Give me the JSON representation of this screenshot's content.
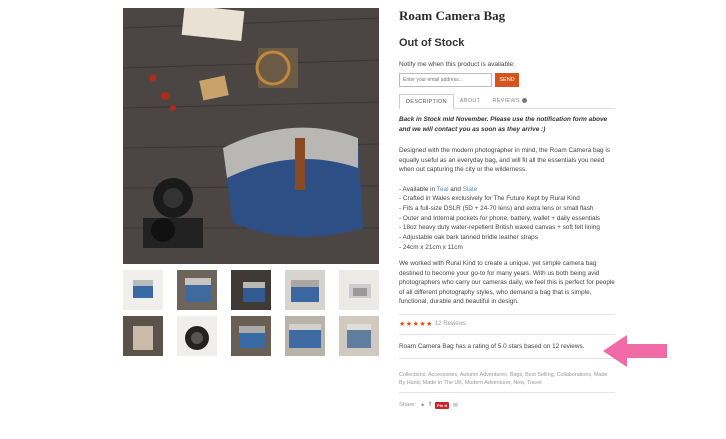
{
  "product": {
    "title": "Roam Camera Bag",
    "stock_status": "Out of Stock",
    "notify_text": "Notify me when this product is available:",
    "email_placeholder": "Enter your email address...",
    "send_label": "SEND"
  },
  "tabs": [
    {
      "label": "DESCRIPTION",
      "active": true
    },
    {
      "label": "ABOUT",
      "active": false
    },
    {
      "label": "REVIEWS",
      "active": false
    }
  ],
  "description": {
    "notice": "Back in Stock mid November. Please use the notification form above and we will contact you as soon as they arrive :)",
    "intro": "Designed with the modern photographer in mind, the Roam Camera bag is equally useful as an everyday bag, and will fit all the essentials you need when out capturing the city or the wilderness.",
    "available_prefix": "- Available in ",
    "color_teal": "Teal",
    "and_word": " and ",
    "color_slate": "Slate",
    "features": [
      "- Crafted in Wales exclusively for The Future Kept by Rural Kind",
      "- Fits a full-size DSLR (5D + 24-70 lens) and extra lens or small flash",
      "- Outer and Internal pockets for phone, battery, wallet + daily essentials",
      "- 18oz heavy duty water-repellent British waxed canvas + soft felt lining",
      "- Adjustable oak bark tanned bridle leather straps",
      "- 24cm x 21cm x 11cm"
    ],
    "closing": "We worked with Rural Kind to create a unique, yet simple camera bag destined to become your go-to for many years. With us both being avid photographers who carry our cameras daily, we feel this is perfect for people of all different photography styles, who demand a bag that is simple, functional, durable and beautiful in design."
  },
  "rating": {
    "stars": 5,
    "review_count_label": "12 Reviews",
    "summary": "Roam Camera Bag has a rating of 5.0 stars based on 12 reviews."
  },
  "collections": "Collections: Accessories, Autumn Adventures, Bags, Best Selling, Collaborations, Made By Hand, Made In The UK, Modern Adventurer, New, Travel",
  "share": {
    "label": "Share:",
    "pin_label": "Pin it"
  },
  "colors": {
    "accent": "#d5541c",
    "arrow": "#f06aa8",
    "link": "#5b8db8"
  }
}
